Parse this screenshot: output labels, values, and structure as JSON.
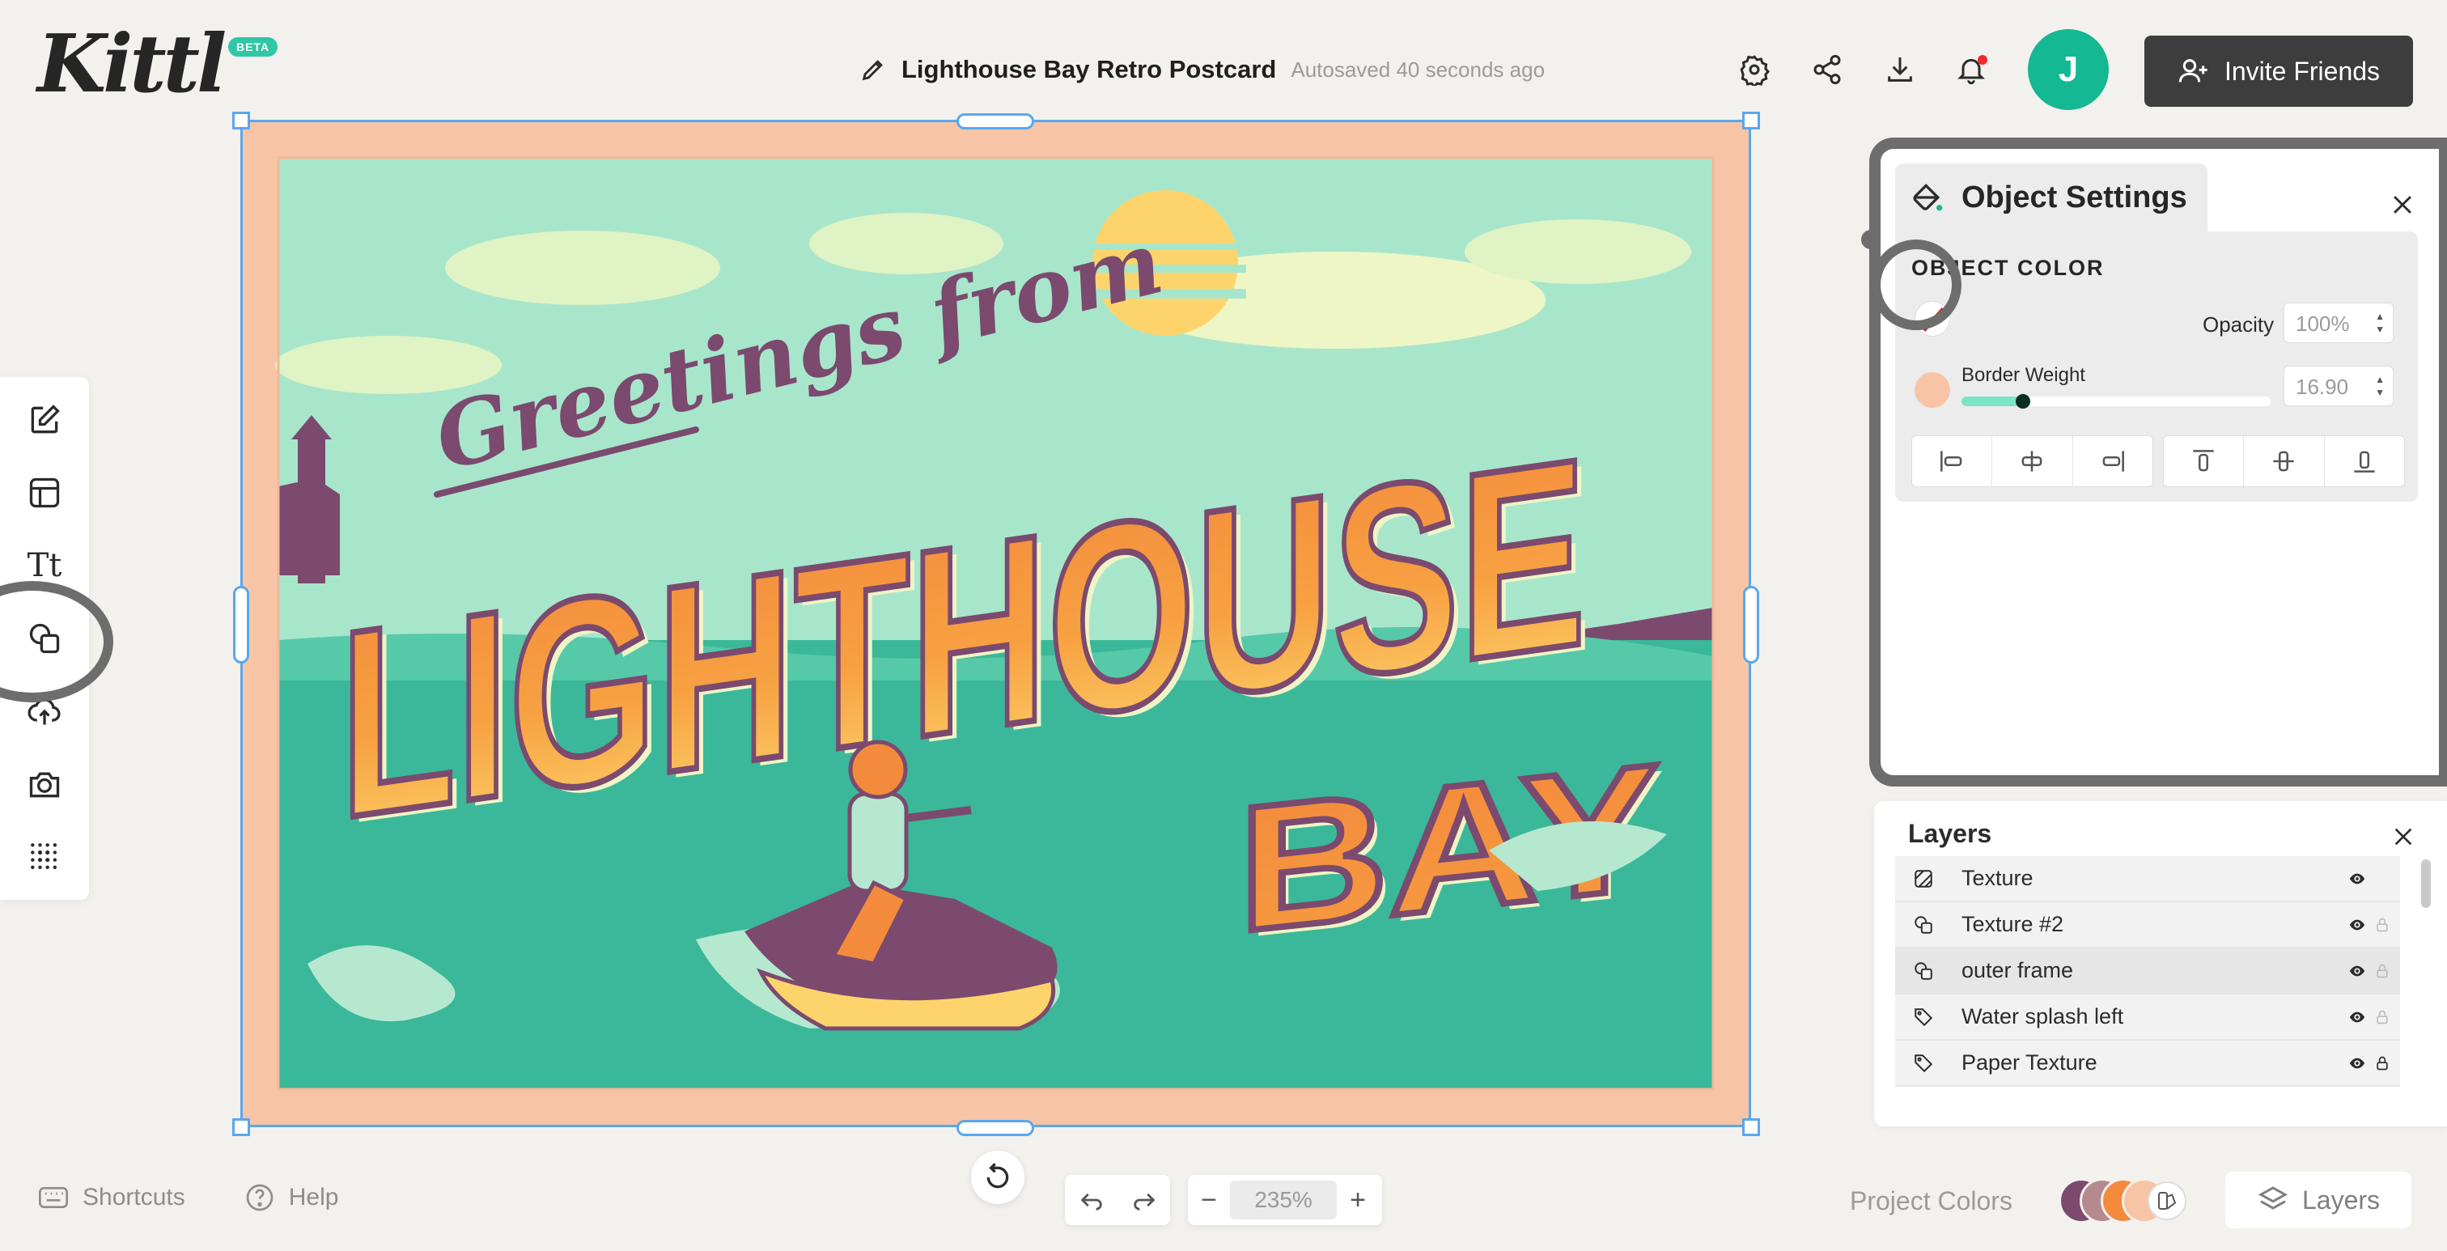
{
  "app": {
    "logo": "Kittl",
    "badge": "BETA"
  },
  "header": {
    "doc_title": "Lighthouse Bay Retro Postcard",
    "autosave": "Autosaved 40 seconds ago",
    "avatar_initial": "J",
    "invite_label": "Invite Friends",
    "icons": [
      "settings-icon",
      "share-icon",
      "download-icon",
      "bell-icon"
    ]
  },
  "toolbar": {
    "items": [
      "edit",
      "templates",
      "text",
      "elements",
      "uploads",
      "photos",
      "textures"
    ],
    "text_tool_glyph": "Tt"
  },
  "canvas": {
    "postcard": {
      "line1": "Greetings from",
      "line2": "LIGHTHOUSE",
      "line3": "BAY"
    },
    "colors": {
      "frame": "#f7c5a5",
      "sky": "#a8e6cb",
      "sea": "#3bb89a",
      "accent": "#f48a3c",
      "yellow": "#fdd46c",
      "purple": "#7b4a6e"
    }
  },
  "object_settings": {
    "title": "Object Settings",
    "section": "OBJECT COLOR",
    "opacity_label": "Opacity",
    "opacity_value": "100%",
    "border_weight_label": "Border Weight",
    "border_weight_value": "16.90",
    "border_weight_fraction": 0.2,
    "border_color": "#f7c5a5",
    "fill": "none"
  },
  "layers": {
    "title": "Layers",
    "items": [
      {
        "name": "Texture",
        "icon": "texture-icon",
        "selected": false,
        "lock": false
      },
      {
        "name": "Texture #2",
        "icon": "shape-icon",
        "selected": false,
        "lock": true
      },
      {
        "name": "outer frame",
        "icon": "shape-icon",
        "selected": true,
        "lock": true
      },
      {
        "name": "Water splash left",
        "icon": "tag-icon",
        "selected": false,
        "lock": true
      },
      {
        "name": "Paper Texture",
        "icon": "tag-icon",
        "selected": false,
        "lock": true
      }
    ]
  },
  "bottom": {
    "shortcuts": "Shortcuts",
    "help": "Help",
    "zoom": "235%",
    "zoom_minus": "−",
    "zoom_plus": "+",
    "project_colors": "Project Colors",
    "project_swatches": [
      "#7b4a6e",
      "#b48a8e",
      "#f48a3c",
      "#f7c5a5"
    ],
    "layers_button": "Layers"
  }
}
